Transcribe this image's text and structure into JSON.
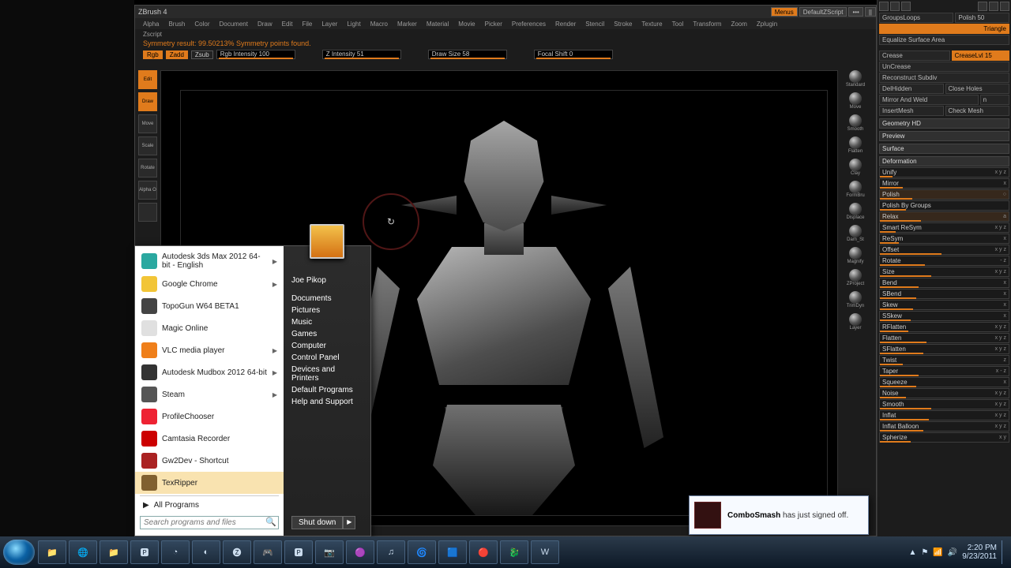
{
  "app": {
    "title": "ZBrush 4",
    "sublabel": "Zscript",
    "title_buttons": {
      "menus": "Menus",
      "script": "DefaultZScript"
    },
    "menus": [
      "Alpha",
      "Brush",
      "Color",
      "Document",
      "Draw",
      "Edit",
      "File",
      "Layer",
      "Light",
      "Macro",
      "Marker",
      "Material",
      "Movie",
      "Picker",
      "Preferences",
      "Render",
      "Stencil",
      "Stroke",
      "Texture",
      "Tool",
      "Transform",
      "Zoom",
      "Zplugin"
    ]
  },
  "status": "Symmetry result: 99.50213% Symmetry points found.",
  "sliders_top": {
    "rgb": "Rgb",
    "zadd": "Zadd",
    "zsub": "Zsub",
    "rgb_int": "Rgb Intensity 100",
    "z_int": "Z Intensity 51",
    "draw": "Draw Size 58",
    "focal": "Focal Shift 0"
  },
  "left_tools": [
    {
      "label": "Edit",
      "orange": true
    },
    {
      "label": "Draw",
      "orange": true
    },
    {
      "label": "Move"
    },
    {
      "label": "Scale"
    },
    {
      "label": "Rotate"
    },
    {
      "label": "Alpha O"
    },
    {
      "label": ""
    }
  ],
  "right_tools": [
    "Standard",
    "Move",
    "Smooth",
    "Flatten",
    "Clay",
    "FormBru",
    "Displace",
    "Dam_St",
    "Magnify",
    "ZProject",
    "TrimDyn",
    "Layer"
  ],
  "props": {
    "top_pair": {
      "a": "GroupsLoops",
      "b": "Polish 50"
    },
    "triangle": "Triangle",
    "equalize": "Equalize Surface Area",
    "crease": {
      "a": "Crease",
      "b": "CreaseLvl 15"
    },
    "btns": [
      "UnCrease",
      "Reconstruct Subdiv"
    ],
    "pair1": {
      "a": "DelHidden",
      "b": "Close Holes"
    },
    "mirror": {
      "a": "Mirror And Weld",
      "b": "n"
    },
    "pair2": {
      "a": "InsertMesh",
      "b": "Check Mesh"
    },
    "sections": [
      "Geometry HD",
      "Preview",
      "Surface",
      "Deformation"
    ],
    "def": [
      {
        "l": "Unify",
        "v": "x y z",
        "p": 10
      },
      {
        "l": "Mirror",
        "v": "x",
        "p": 18
      },
      {
        "l": "Polish",
        "v": "○",
        "p": 25,
        "hi": true
      },
      {
        "l": "Polish By Groups",
        "v": "",
        "p": 20
      },
      {
        "l": "Relax",
        "v": "a",
        "p": 32,
        "hi": true
      },
      {
        "l": "Smart ReSym",
        "v": "x y z",
        "p": 12
      },
      {
        "l": "ReSym",
        "v": "x",
        "p": 15
      },
      {
        "l": "Offset",
        "v": "x y z",
        "p": 48
      },
      {
        "l": "Rotate",
        "v": "- z",
        "p": 35
      },
      {
        "l": "Size",
        "v": "x y z",
        "p": 40
      },
      {
        "l": "Bend",
        "v": "x",
        "p": 30
      },
      {
        "l": "SBend",
        "v": "x",
        "p": 28
      },
      {
        "l": "Skew",
        "v": "x",
        "p": 26
      },
      {
        "l": "SSkew",
        "v": "x",
        "p": 24
      },
      {
        "l": "RFlatten",
        "v": "x y z",
        "p": 22
      },
      {
        "l": "Flatten",
        "v": "x y z",
        "p": 36
      },
      {
        "l": "SFlatten",
        "v": "x y z",
        "p": 34
      },
      {
        "l": "Twist",
        "v": "z",
        "p": 18
      },
      {
        "l": "Taper",
        "v": "x - z",
        "p": 30
      },
      {
        "l": "Squeeze",
        "v": "x",
        "p": 28
      },
      {
        "l": "Noise",
        "v": "x y z",
        "p": 20
      },
      {
        "l": "Smooth",
        "v": "x y z",
        "p": 40
      },
      {
        "l": "Inflat",
        "v": "x y z",
        "p": 38
      },
      {
        "l": "Inflat Balloon",
        "v": "x y z",
        "p": 34
      },
      {
        "l": "Spherize",
        "v": "x y",
        "p": 24
      }
    ]
  },
  "start": {
    "left": [
      {
        "label": "Autodesk 3ds Max 2012 64-bit - English",
        "arrow": true,
        "color": "#2aa8a0"
      },
      {
        "label": "Google Chrome",
        "arrow": true,
        "color": "#f2c537"
      },
      {
        "label": "TopoGun W64 BETA1",
        "color": "#444"
      },
      {
        "label": "Magic Online",
        "color": "#e0e0e0"
      },
      {
        "label": "VLC media player",
        "arrow": true,
        "color": "#ef7f1a"
      },
      {
        "label": "Autodesk Mudbox 2012 64-bit",
        "arrow": true,
        "color": "#333"
      },
      {
        "label": "Steam",
        "arrow": true,
        "color": "#555"
      },
      {
        "label": "ProfileChooser",
        "color": "#e23"
      },
      {
        "label": "Camtasia Recorder",
        "color": "#c00"
      },
      {
        "label": "Gw2Dev - Shortcut",
        "color": "#a22"
      },
      {
        "label": "TexRipper",
        "hover": true,
        "color": "#806030"
      }
    ],
    "all": "All Programs",
    "search_ph": "Search programs and files",
    "right_user": "Joe Pikop",
    "right": [
      "Documents",
      "Pictures",
      "Music",
      "Games",
      "Computer",
      "Control Panel",
      "Devices and Printers",
      "Default Programs",
      "Help and Support"
    ],
    "shutdown": "Shut down"
  },
  "toast": {
    "name": "ComboSmash",
    "msg": " has just signed off."
  },
  "taskbar": {
    "apps_count": 17,
    "clock": {
      "time": "2:20 PM",
      "date": "9/23/2011"
    }
  }
}
